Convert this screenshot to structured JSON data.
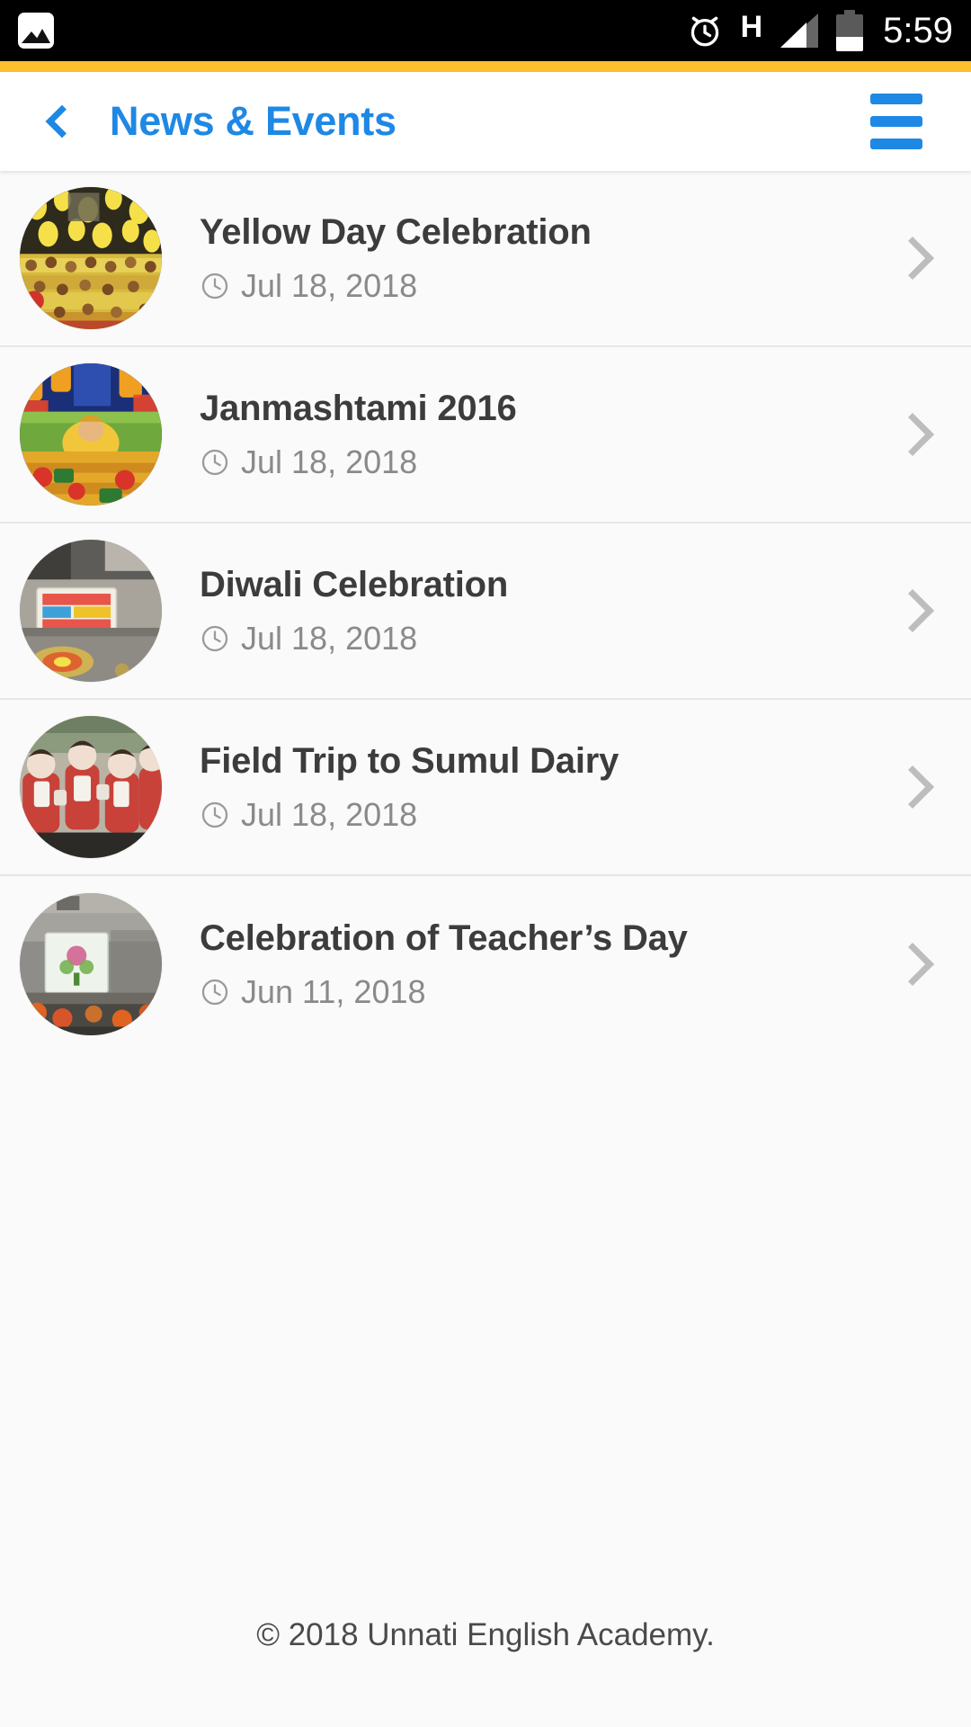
{
  "status_bar": {
    "notification_icon": "gallery-icon",
    "alarm_icon": "alarm-clock-icon",
    "network_type": "H",
    "signal_icon": "signal-bars-icon",
    "battery_icon": "battery-icon",
    "battery_level_percent": 40,
    "time": "5:59",
    "background_color": "#000000"
  },
  "accent": {
    "color": "#FBC02D"
  },
  "header": {
    "back_icon": "chevron-left-icon",
    "title": "News & Events",
    "menu_icon": "hamburger-menu-icon",
    "title_color": "#1E88E5",
    "background_color": "#FFFFFF"
  },
  "list": {
    "date_icon": "clock-icon",
    "chevron_icon": "chevron-right-icon",
    "items": [
      {
        "title": "Yellow Day Celebration",
        "date": "Jul 18, 2018",
        "thumbnail": "yellow-day-celebration-photo"
      },
      {
        "title": "Janmashtami 2016",
        "date": "Jul 18, 2018",
        "thumbnail": "janmashtami-photo"
      },
      {
        "title": "Diwali Celebration",
        "date": "Jul 18, 2018",
        "thumbnail": "diwali-celebration-photo"
      },
      {
        "title": "Field Trip to Sumul Dairy",
        "date": "Jul 18, 2018",
        "thumbnail": "field-trip-sumul-dairy-photo"
      },
      {
        "title": "Celebration of Teacher’s Day",
        "date": "Jun 11, 2018",
        "thumbnail": "teachers-day-photo"
      }
    ]
  },
  "footer": {
    "copyright": "© 2018 Unnati English Academy."
  }
}
